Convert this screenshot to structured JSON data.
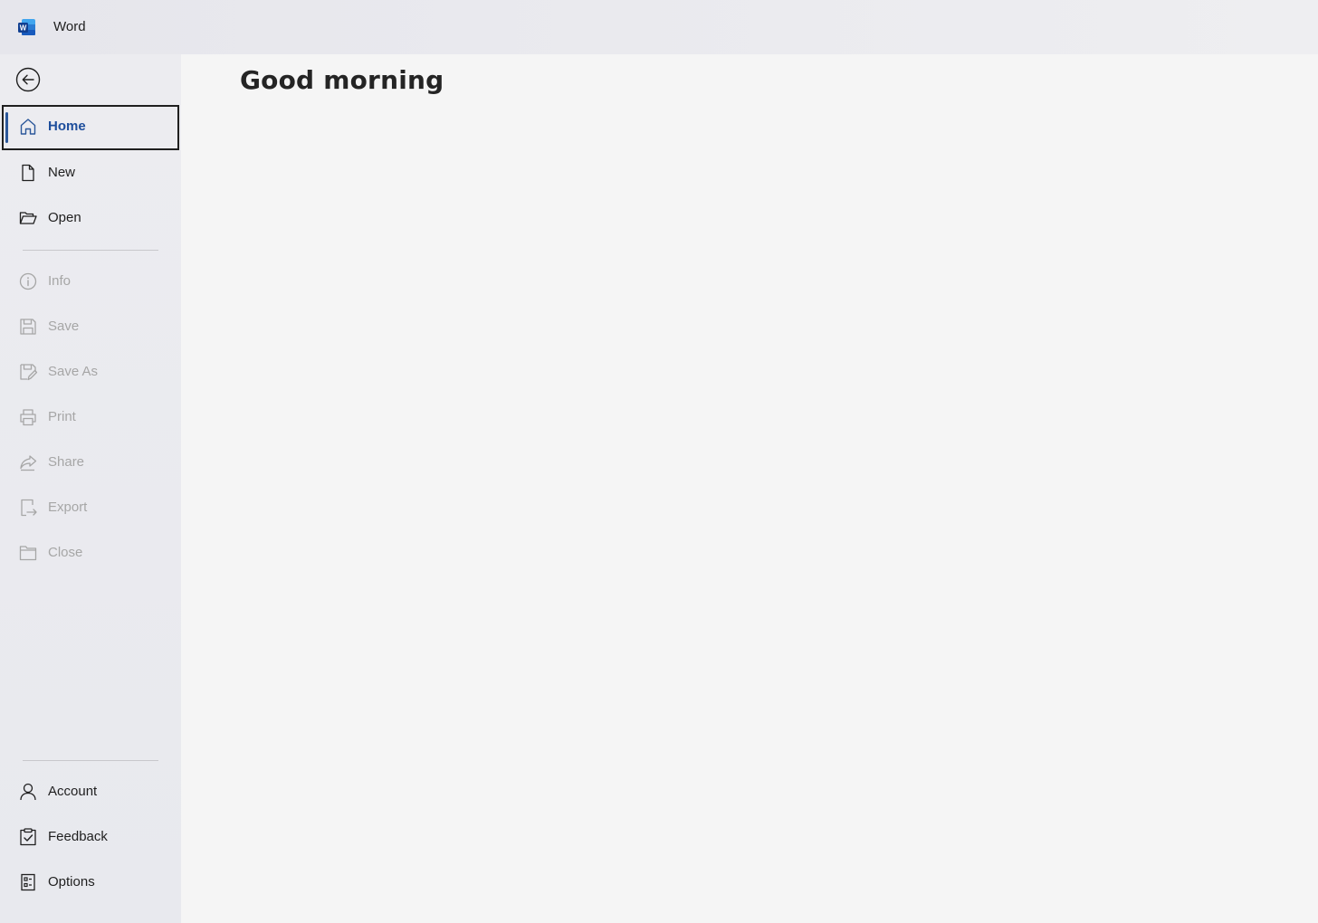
{
  "app": {
    "name": "Word",
    "accent_color": "#2b579a"
  },
  "sidebar": {
    "back_icon": "back-arrow-icon",
    "primary_items": [
      {
        "label": "Home",
        "icon": "home-icon",
        "state": "selected"
      },
      {
        "label": "New",
        "icon": "new-document-icon",
        "state": "enabled"
      },
      {
        "label": "Open",
        "icon": "open-folder-icon",
        "state": "enabled"
      }
    ],
    "file_items": [
      {
        "label": "Info",
        "icon": "info-icon",
        "state": "disabled"
      },
      {
        "label": "Save",
        "icon": "save-icon",
        "state": "disabled"
      },
      {
        "label": "Save As",
        "icon": "save-as-icon",
        "state": "disabled"
      },
      {
        "label": "Print",
        "icon": "print-icon",
        "state": "disabled"
      },
      {
        "label": "Share",
        "icon": "share-icon",
        "state": "disabled"
      },
      {
        "label": "Export",
        "icon": "export-icon",
        "state": "disabled"
      },
      {
        "label": "Close",
        "icon": "close-folder-icon",
        "state": "disabled"
      }
    ],
    "bottom_items": [
      {
        "label": "Account",
        "icon": "account-icon",
        "state": "enabled"
      },
      {
        "label": "Feedback",
        "icon": "feedback-icon",
        "state": "enabled"
      },
      {
        "label": "Options",
        "icon": "options-icon",
        "state": "enabled"
      }
    ]
  },
  "main": {
    "greeting": "Good morning"
  }
}
